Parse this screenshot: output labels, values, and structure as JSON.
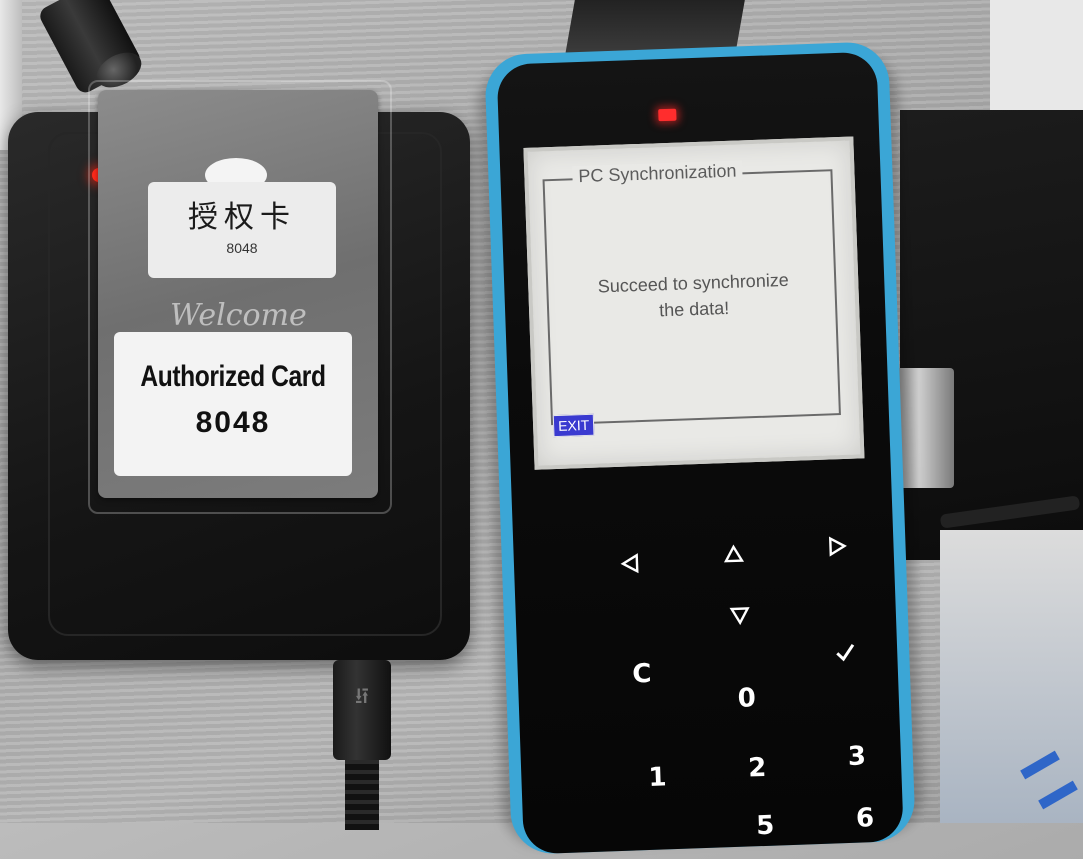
{
  "card": {
    "chinese_label": "授权卡",
    "top_number": "8048",
    "title": "Authorized Card",
    "bottom_number": "8048",
    "script_text": "Welcome"
  },
  "screen": {
    "title": "PC Synchronization",
    "message_line1": "Succeed to synchronize",
    "message_line2": "the data!",
    "exit_label": "EXIT"
  },
  "keypad": {
    "arrows": [
      "left-arrow-icon",
      "up-arrow-icon",
      "right-arrow-icon",
      "down-arrow-icon",
      "check-icon"
    ],
    "keys": [
      "C",
      "0",
      "1",
      "2",
      "3",
      "5",
      "6"
    ]
  },
  "colors": {
    "device_shell": "#3ba6d6",
    "indicator_led": "#ff2d2d",
    "exit_highlight": "#3a3ad0"
  }
}
